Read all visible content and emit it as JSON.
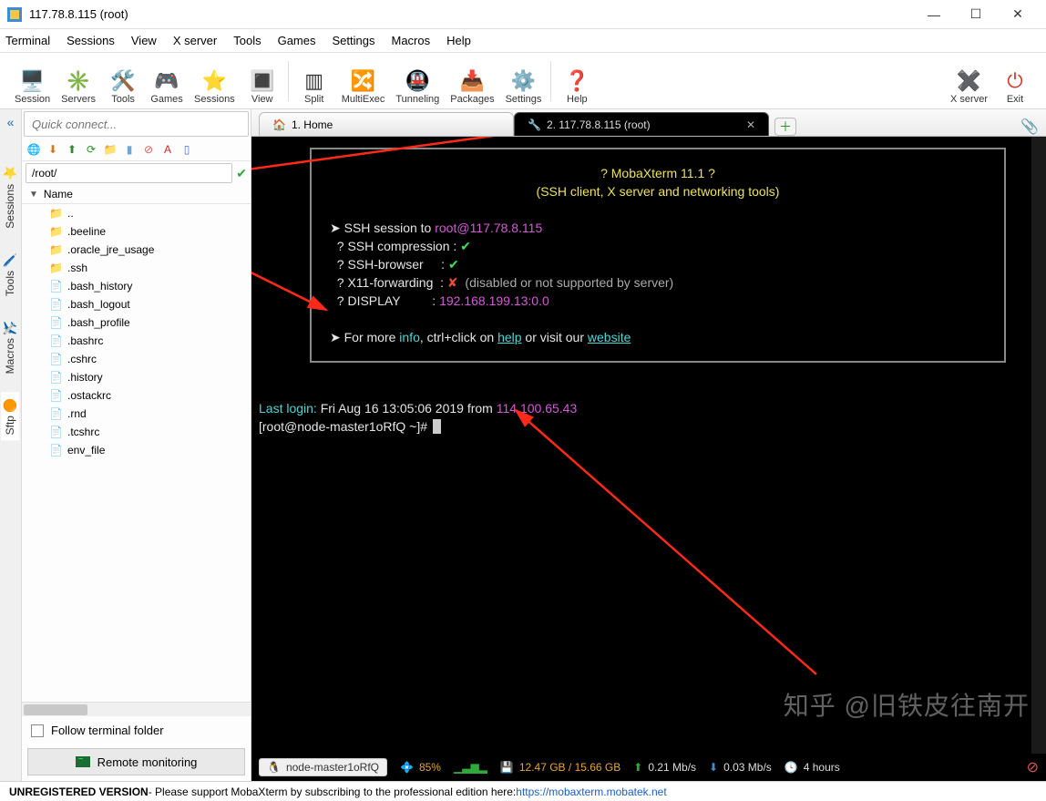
{
  "window": {
    "title": "117.78.8.115 (root)"
  },
  "menu": [
    "Terminal",
    "Sessions",
    "View",
    "X server",
    "Tools",
    "Games",
    "Settings",
    "Macros",
    "Help"
  ],
  "toolbar": [
    {
      "label": "Session",
      "icon": "🖥️"
    },
    {
      "label": "Servers",
      "icon": "✳️"
    },
    {
      "label": "Tools",
      "icon": "🛠️"
    },
    {
      "label": "Games",
      "icon": "🎮"
    },
    {
      "label": "Sessions",
      "icon": "⭐"
    },
    {
      "label": "View",
      "icon": "🔳"
    },
    {
      "label": "Split",
      "icon": "▥"
    },
    {
      "label": "MultiExec",
      "icon": "🔀"
    },
    {
      "label": "Tunneling",
      "icon": "🚇"
    },
    {
      "label": "Packages",
      "icon": "📥"
    },
    {
      "label": "Settings",
      "icon": "⚙️"
    },
    {
      "label": "Help",
      "icon": "❓"
    }
  ],
  "toolbar_right": [
    {
      "label": "X server",
      "icon": "✖️"
    },
    {
      "label": "Exit",
      "icon": "⏻"
    }
  ],
  "quick_connect": {
    "placeholder": "Quick connect..."
  },
  "vtabs": [
    {
      "label": "Sessions",
      "icon": "⭐"
    },
    {
      "label": "Tools",
      "icon": "🖊️"
    },
    {
      "label": "Macros",
      "icon": "✈️"
    },
    {
      "label": "Sftp",
      "icon": "🟠"
    }
  ],
  "sftp": {
    "path": "/root/",
    "header": "Name",
    "items": [
      {
        "name": "..",
        "type": "up"
      },
      {
        "name": ".beeline",
        "type": "folder"
      },
      {
        "name": ".oracle_jre_usage",
        "type": "folder"
      },
      {
        "name": ".ssh",
        "type": "folder"
      },
      {
        "name": ".bash_history",
        "type": "file"
      },
      {
        "name": ".bash_logout",
        "type": "file"
      },
      {
        "name": ".bash_profile",
        "type": "file"
      },
      {
        "name": ".bashrc",
        "type": "file"
      },
      {
        "name": ".cshrc",
        "type": "file"
      },
      {
        "name": ".history",
        "type": "file"
      },
      {
        "name": ".ostackrc",
        "type": "file"
      },
      {
        "name": ".rnd",
        "type": "file"
      },
      {
        "name": ".tcshrc",
        "type": "file"
      },
      {
        "name": "env_file",
        "type": "file"
      }
    ],
    "follow_label": "Follow terminal folder",
    "remote_monitoring": "Remote monitoring"
  },
  "tabs": [
    {
      "label": "1. Home",
      "icon": "🏠",
      "active": false
    },
    {
      "label": "2. 117.78.8.115 (root)",
      "icon": "🔧",
      "active": true
    }
  ],
  "terminal": {
    "banner_title": "? MobaXterm 11.1 ?",
    "banner_sub": "(SSH client, X server and networking tools)",
    "ssh_to_prefix": "➤ SSH session to ",
    "ssh_to_user": "root@117.78.8.115",
    "compression": "? SSH compression : ",
    "browser": "? SSH-browser     : ",
    "x11": "? X11-forwarding  : ",
    "x11_msg": "  (disabled or not supported by server)",
    "display_lbl": "? DISPLAY         : ",
    "display_val": "192.168.199.13:0.0",
    "info_line_a": "➤ For more ",
    "info": "info",
    "info_mid": ", ctrl+click on ",
    "help": "help",
    "info_mid2": " or visit our ",
    "website": "website",
    "last_login_lbl": "Last login: ",
    "last_login_time": "Fri Aug 16 13:05:06 2019 from ",
    "last_login_ip": "114.100.65.43",
    "prompt": "[root@node-master1oRfQ ~]# "
  },
  "status": {
    "node": "node-master1oRfQ",
    "cpu": "85%",
    "mem": "12.47 GB / 15.66 GB",
    "up": "0.21 Mb/s",
    "down": "0.03 Mb/s",
    "uptime": "4 hours"
  },
  "watermark": "知乎 @旧铁皮往南开",
  "footer": {
    "unreg": "UNREGISTERED VERSION",
    "msg": " -  Please support MobaXterm by subscribing to the professional edition here:  ",
    "link": "https://mobaxterm.mobatek.net"
  }
}
